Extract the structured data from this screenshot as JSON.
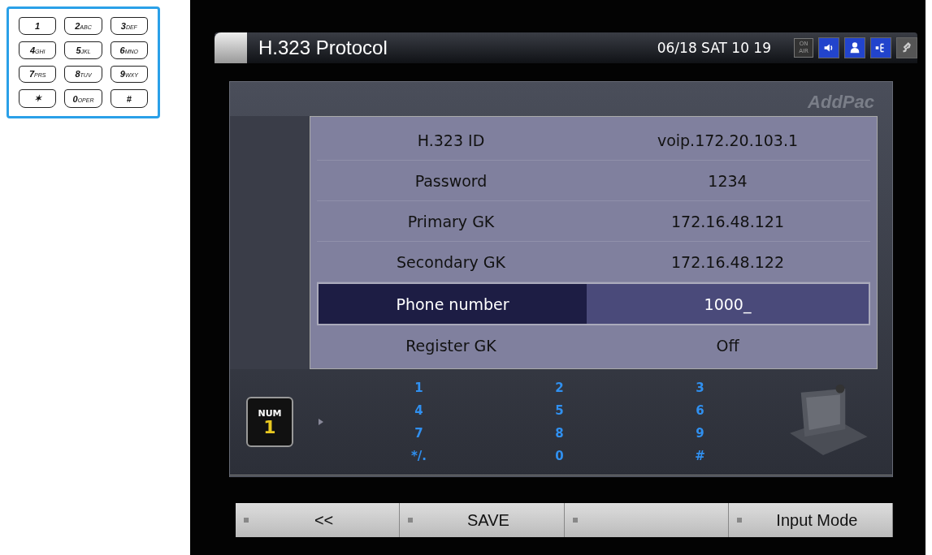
{
  "keypad": [
    {
      "digit": "1"
    },
    {
      "digit": "2",
      "letters": "ABC"
    },
    {
      "digit": "3",
      "letters": "DEF"
    },
    {
      "digit": "4",
      "letters": "GHI"
    },
    {
      "digit": "5",
      "letters": "JKL"
    },
    {
      "digit": "6",
      "letters": "MNO"
    },
    {
      "digit": "7",
      "letters": "PRS"
    },
    {
      "digit": "8",
      "letters": "TUV"
    },
    {
      "digit": "9",
      "letters": "WXY"
    },
    {
      "digit": "✶"
    },
    {
      "digit": "0",
      "letters": "OPER"
    },
    {
      "digit": "#"
    }
  ],
  "header": {
    "title": "H.323 Protocol",
    "datetime": "06/18 SAT 10 19",
    "on_air": "ON AIR",
    "status_icons": [
      {
        "kind": "speaker",
        "on": true
      },
      {
        "kind": "person",
        "on": true
      },
      {
        "kind": "network",
        "on": true
      },
      {
        "kind": "phone",
        "on": false
      }
    ]
  },
  "brand": "AddPac",
  "settings": [
    {
      "label": "H.323 ID",
      "value": "voip.172.20.103.1",
      "selected": false
    },
    {
      "label": "Password",
      "value": "1234",
      "selected": false
    },
    {
      "label": "Primary GK",
      "value": "172.16.48.121",
      "selected": false
    },
    {
      "label": "Secondary GK",
      "value": "172.16.48.122",
      "selected": false
    },
    {
      "label": "Phone number",
      "value": "1000_",
      "selected": true
    },
    {
      "label": "Register GK",
      "value": "Off",
      "selected": false
    }
  ],
  "input_mode": {
    "label": "NUM",
    "number": "1"
  },
  "number_keys": [
    [
      "1",
      "4",
      "7",
      "*/."
    ],
    [
      "2",
      "5",
      "8",
      "0"
    ],
    [
      "3",
      "6",
      "9",
      "#"
    ]
  ],
  "softkeys": [
    {
      "kind": "label",
      "label": "<<"
    },
    {
      "kind": "label",
      "label": "SAVE"
    },
    {
      "kind": "blank"
    },
    {
      "kind": "label",
      "label": "Input Mode"
    }
  ]
}
